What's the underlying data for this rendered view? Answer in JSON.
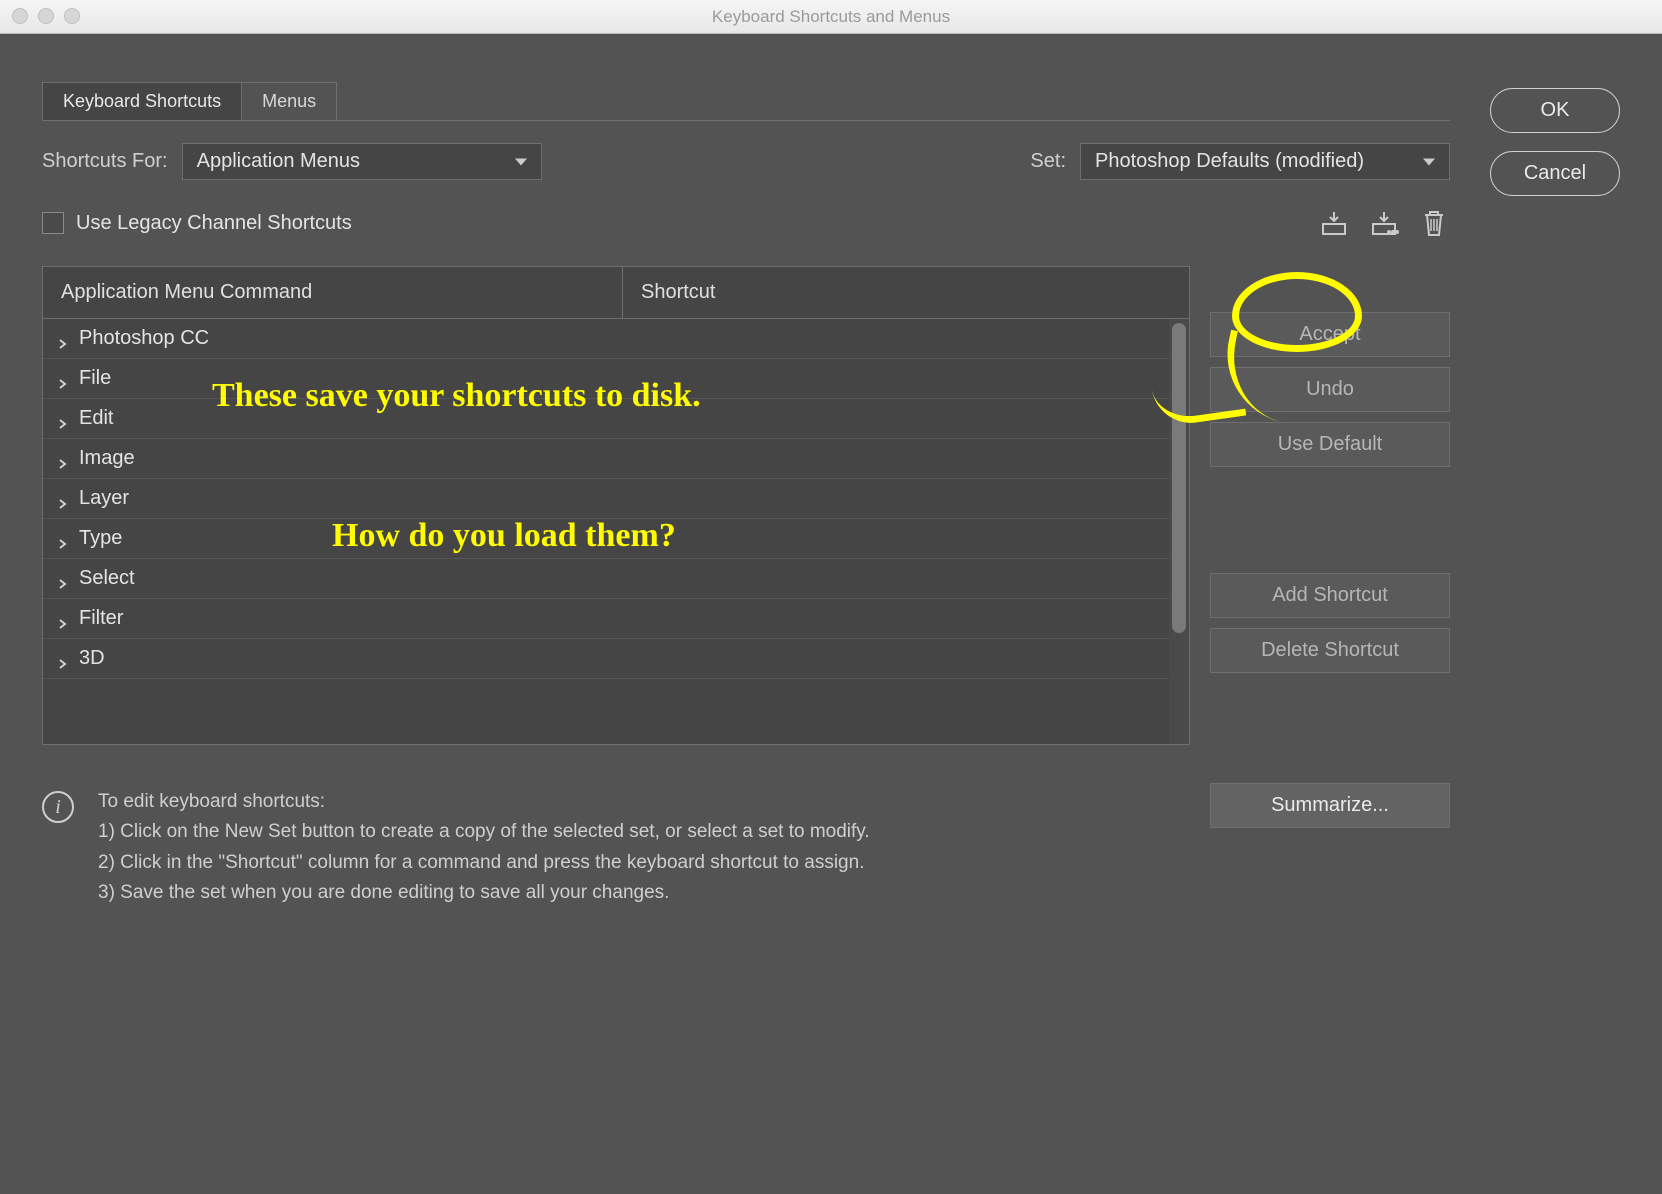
{
  "window": {
    "title": "Keyboard Shortcuts and Menus"
  },
  "tabs": {
    "shortcuts": "Keyboard Shortcuts",
    "menus": "Menus"
  },
  "shortcutsFor": {
    "label": "Shortcuts For:",
    "value": "Application Menus"
  },
  "set": {
    "label": "Set:",
    "value": "Photoshop Defaults (modified)"
  },
  "legacy": {
    "label": "Use Legacy Channel Shortcuts"
  },
  "table": {
    "col1": "Application Menu Command",
    "col2": "Shortcut",
    "rows": [
      "Photoshop CC",
      "File",
      "Edit",
      "Image",
      "Layer",
      "Type",
      "Select",
      "Filter",
      "3D"
    ]
  },
  "buttons": {
    "accept": "Accept",
    "undo": "Undo",
    "useDefault": "Use Default",
    "addShortcut": "Add Shortcut",
    "deleteShortcut": "Delete Shortcut",
    "summarize": "Summarize..."
  },
  "info": {
    "heading": "To edit keyboard shortcuts:",
    "l1": "1) Click on the New Set button to create a copy of the selected set, or select a set to modify.",
    "l2": "2) Click in the \"Shortcut\" column for a command and press the keyboard shortcut to assign.",
    "l3": "3) Save the set when you are done editing to save all your changes."
  },
  "dialogButtons": {
    "ok": "OK",
    "cancel": "Cancel"
  },
  "annotations": {
    "a1": "These save your shortcuts to disk.",
    "a2": "How do you load them?"
  }
}
